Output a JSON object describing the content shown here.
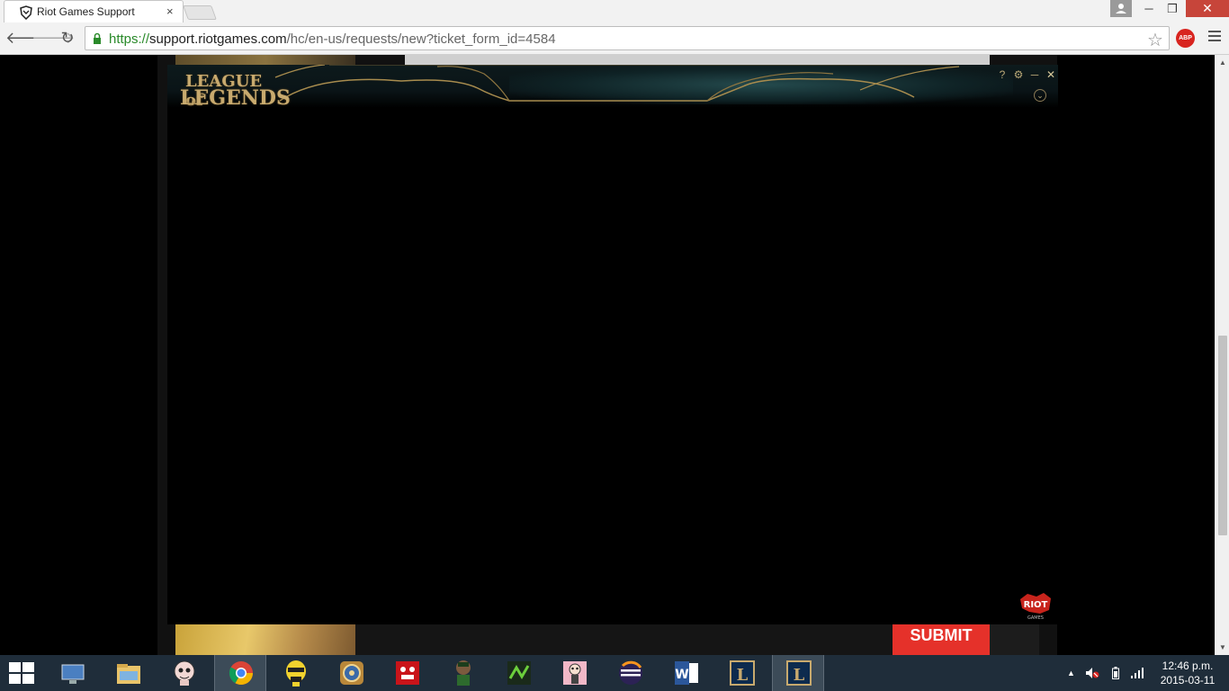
{
  "browser": {
    "tab_title": "Riot Games Support",
    "tab_close": "×",
    "url_scheme": "https://",
    "url_host": "support.riotgames.com",
    "url_path": "/hc/en-us/requests/new?ticket_form_id=4584",
    "abp_label": "ABP",
    "window_minimize": "─",
    "window_restore": "❐",
    "window_close": "✕"
  },
  "page": {
    "submit_label": "SUBMIT"
  },
  "lol_client": {
    "logo_line1": "LEAGUE of",
    "logo_line2": "LEGENDS",
    "help_label": "?",
    "settings_label": "⚙",
    "minimize_label": "─",
    "close_label": "✕",
    "expand_label": "⌄",
    "riot_logo_text": "RIOT",
    "riot_logo_sub": "GAMES"
  },
  "taskbar": {
    "apps": [
      {
        "icon": "computer-icon"
      },
      {
        "icon": "file-explorer-icon"
      },
      {
        "icon": "binding-of-isaac-icon"
      },
      {
        "icon": "chrome-icon"
      },
      {
        "icon": "yellow-skull-icon"
      },
      {
        "icon": "hearthstone-icon"
      },
      {
        "icon": "super-meat-boy-icon"
      },
      {
        "icon": "character-avatar-icon"
      },
      {
        "icon": "green-game-icon"
      },
      {
        "icon": "pink-character-icon"
      },
      {
        "icon": "eclipse-icon"
      },
      {
        "icon": "word-icon"
      },
      {
        "icon": "league-of-legends-icon"
      },
      {
        "icon": "league-of-legends-icon"
      }
    ],
    "active_index": 3,
    "time": "12:46 p.m.",
    "date": "2015-03-11"
  },
  "colors": {
    "submit_red": "#e5312a",
    "lol_gold": "#c8aa6e",
    "taskbar": "#1f2d3a"
  }
}
